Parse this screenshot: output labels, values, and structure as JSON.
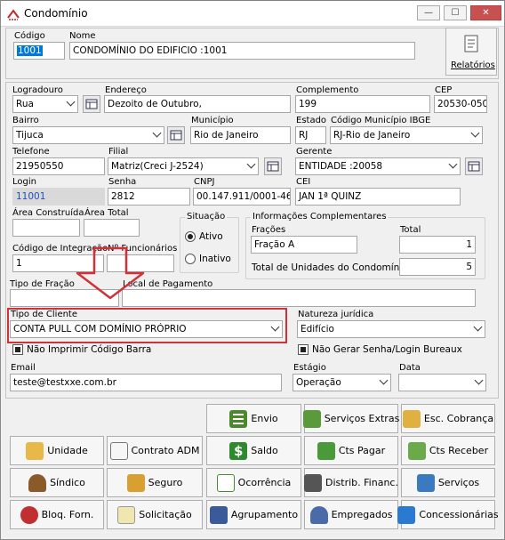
{
  "window": {
    "title": "Condomínio",
    "min": "—",
    "max": "☐",
    "close": "✕"
  },
  "top": {
    "codigo_label": "Código",
    "codigo_value": "1001",
    "nome_label": "Nome",
    "nome_value": "CONDOMÍNIO DO EDIFICIO :1001",
    "relatorios_label": "Relatórios"
  },
  "fields": {
    "logradouro_label": "Logradouro",
    "logradouro_value": "Rua",
    "endereco_label": "Endereço",
    "endereco_value": "Dezoito de Outubro,",
    "complemento_label": "Complemento",
    "complemento_value": "199",
    "cep_label": "CEP",
    "cep_value": "20530-050",
    "bairro_label": "Bairro",
    "bairro_value": "Tijuca",
    "municipio_label": "Município",
    "municipio_value": "Rio de Janeiro",
    "estado_label": "Estado",
    "estado_value": "RJ",
    "codmun_label": "Código Município IBGE",
    "codmun_value": "RJ-Rio de Janeiro",
    "telefone_label": "Telefone",
    "telefone_value": "21950550",
    "filial_label": "Filial",
    "filial_value": "Matriz(Creci J-2524)",
    "gerente_label": "Gerente",
    "gerente_value": "ENTIDADE :20058",
    "login_label": "Login",
    "login_value": "11001",
    "senha_label": "Senha",
    "senha_value": "2812",
    "cnpj_label": "CNPJ",
    "cnpj_value": "00.147.911/0001-46",
    "cei_label": "CEI",
    "cei_value": "JAN 1ª QUINZ",
    "area_construida_label": "Área Construída",
    "area_total_label": "Área Total",
    "cod_integracao_label": "Código de Integração",
    "cod_integracao_value": "1",
    "num_funcionarios_label": "Nº Funcionários",
    "situacao_label": "Situação",
    "ativo_label": "Ativo",
    "inativo_label": "Inativo",
    "info_label": "Informações Complementares",
    "fracoes_label": "Frações",
    "fracoes_value": "Fração A",
    "total_label": "Total",
    "total_value": "1",
    "total_unidades_label": "Total de Unidades do Condomínio",
    "total_unidades_value": "5",
    "tipo_fracao_label": "Tipo de Fração",
    "local_pagamento_label": "Local de Pagamento",
    "tipo_cliente_label": "Tipo de Cliente",
    "tipo_cliente_value": "CONTA PULL COM DOMÍNIO PRÓPRIO",
    "natureza_label": "Natureza jurídica",
    "natureza_value": "Edifício",
    "nao_imprimir_label": "Não Imprimir Código Barra",
    "nao_gerar_label": "Não Gerar Senha/Login Bureaux",
    "email_label": "Email",
    "email_value": "teste@testxxe.com.br",
    "estagio_label": "Estágio",
    "estagio_value": "Operação",
    "data_label": "Data",
    "data_value": ""
  },
  "buttons": {
    "envio": "Envio",
    "servicos_extras": "Serviços Extras",
    "esc_cobranca": "Esc. Cobrança",
    "unidade": "Unidade",
    "contrato_adm": "Contrato ADM",
    "saldo": "Saldo",
    "cts_pagar": "Cts Pagar",
    "cts_receber": "Cts Receber",
    "sindico": "Síndico",
    "seguro": "Seguro",
    "ocorrencia": "Ocorrência",
    "distrib_financ": "Distrib. Financ.",
    "servicos": "Serviços",
    "bloq_forn": "Bloq. Forn.",
    "solicitacao": "Solicitação",
    "agrupamento": "Agrupamento",
    "empregados": "Empregados",
    "concessionarias": "Concessionárias"
  },
  "colors": {
    "highlight": "#d0313a",
    "selection": "#0078d7",
    "login_text": "#1f4fbf"
  }
}
